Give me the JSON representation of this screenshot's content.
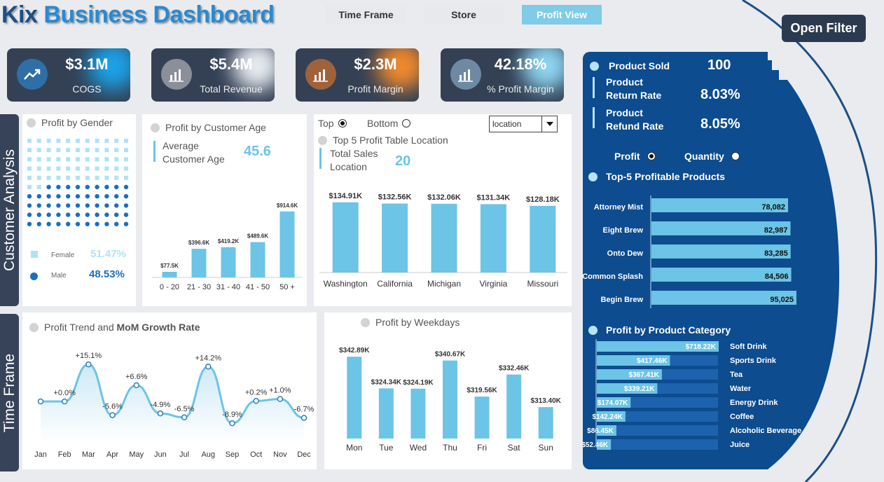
{
  "header": {
    "title_part1": "Kix",
    "title_part2": " Business Dashboard",
    "nav": [
      "Time Frame",
      "Store",
      "Profit View"
    ],
    "open_filter": "Open Filter"
  },
  "kpis": [
    {
      "value": "$3.1M",
      "label": "COGS"
    },
    {
      "value": "$5.4M",
      "label": "Total Revenue"
    },
    {
      "value": "$2.3M",
      "label": "Profit Margin"
    },
    {
      "value": "42.18%",
      "label": "% Profit Margin"
    }
  ],
  "side_tabs": {
    "customer": "Customer Analysis",
    "time": "Time Frame"
  },
  "gender": {
    "title": "Profit by Gender",
    "female_label": "Female",
    "female_pct": "51.47%",
    "male_label": "Male",
    "male_pct": "48.53%",
    "colors": {
      "female": "#aee3f6",
      "male": "#1a6fc2"
    }
  },
  "age": {
    "title": "Profit by Customer Age",
    "avg_label_line1": "Average",
    "avg_label_line2": "Customer Age",
    "avg_value": "45.6"
  },
  "location": {
    "top_label": "Top",
    "bottom_label": "Bottom",
    "dropdown_value": "location",
    "title": "Top 5 Profit Table Location",
    "total_label_line1": "Total Sales",
    "total_label_line2": "Location",
    "total_value": "20"
  },
  "trend": {
    "title_plain": "Profit Trend and ",
    "title_bold": "MoM Growth Rate"
  },
  "weekdays": {
    "title": "Profit by Weekdays"
  },
  "panel": {
    "product_sold_label": "Product Sold",
    "product_sold_value": "100",
    "return_label_line1": "Product",
    "return_label_line2": "Return Rate",
    "return_value": "8.03%",
    "refund_label_line1": "Product",
    "refund_label_line2": "Refund Rate",
    "refund_value": "8.05%",
    "profit_toggle": "Profit",
    "quantity_toggle": "Quantity",
    "top5_title": "Top-5 Profitable Products",
    "category_title": "Profit by Product Category"
  },
  "chart_data": [
    {
      "type": "bar",
      "id": "age",
      "categories": [
        "0 - 20",
        "21 - 30",
        "31 - 40",
        "41 - 50",
        "50 +"
      ],
      "values": [
        77.5,
        396.6,
        419.2,
        489.6,
        914.6
      ],
      "labels": [
        "$77.5K",
        "$396.6K",
        "$419.2K",
        "$489.6K",
        "$914.6K"
      ],
      "ylim": [
        0,
        1000
      ]
    },
    {
      "type": "bar",
      "id": "location",
      "categories": [
        "Washington",
        "California",
        "Michigan",
        "Virginia",
        "Missouri"
      ],
      "values": [
        134.91,
        132.56,
        132.06,
        131.34,
        128.18
      ],
      "labels": [
        "$134.91K",
        "$132.56K",
        "$132.06K",
        "$131.34K",
        "$128.18K"
      ],
      "ylim": [
        0,
        140
      ]
    },
    {
      "type": "area",
      "id": "trend",
      "categories": [
        "Jan",
        "Feb",
        "Mar",
        "Apr",
        "May",
        "Jun",
        "Jul",
        "Aug",
        "Sep",
        "Oct",
        "Nov",
        "Dec"
      ],
      "values": [
        0,
        0.0,
        15.1,
        -5.6,
        6.6,
        -4.9,
        -6.5,
        14.2,
        -8.9,
        0.2,
        1.0,
        -6.7
      ],
      "labels": [
        "",
        "+0.0%",
        "+15.1%",
        "-5.6%",
        "+6.6%",
        "-4.9%",
        "-6.5%",
        "+14.2%",
        "-8.9%",
        "+0.2%",
        "+1.0%",
        "-6.7%"
      ]
    },
    {
      "type": "bar",
      "id": "weekdays",
      "categories": [
        "Mon",
        "Tue",
        "Wed",
        "Thu",
        "Fri",
        "Sat",
        "Sun"
      ],
      "values": [
        342.89,
        324.34,
        324.19,
        340.67,
        319.56,
        332.46,
        313.4
      ],
      "labels": [
        "$342.89K",
        "$324.34K",
        "$324.19K",
        "$340.67K",
        "$319.56K",
        "$332.46K",
        "$313.40K"
      ],
      "ylim": [
        295,
        345
      ]
    },
    {
      "type": "bar",
      "id": "top5",
      "orientation": "horizontal",
      "categories": [
        "Attorney Mist",
        "Eight Brew",
        "Onto Dew",
        "Common Splash",
        "Begin Brew"
      ],
      "values": [
        78082,
        82987,
        83285,
        84506,
        95025
      ],
      "labels": [
        "78,082",
        "82,987",
        "83,285",
        "84,506",
        "95,025"
      ]
    },
    {
      "type": "bar",
      "id": "category",
      "orientation": "horizontal",
      "categories": [
        "Soft Drink",
        "Sports Drink",
        "Tea",
        "Water",
        "Energy Drink",
        "Coffee",
        "Alcoholic Beverage",
        "Juice"
      ],
      "values": [
        718.22,
        417.46,
        367.41,
        339.21,
        174.07,
        142.24,
        86.45,
        52.46
      ],
      "labels": [
        "$718.22K",
        "$417.46K",
        "$367.41K",
        "$339.21K",
        "$174.07K",
        "$142.24K",
        "$86.45K",
        "$52.46K"
      ]
    }
  ]
}
